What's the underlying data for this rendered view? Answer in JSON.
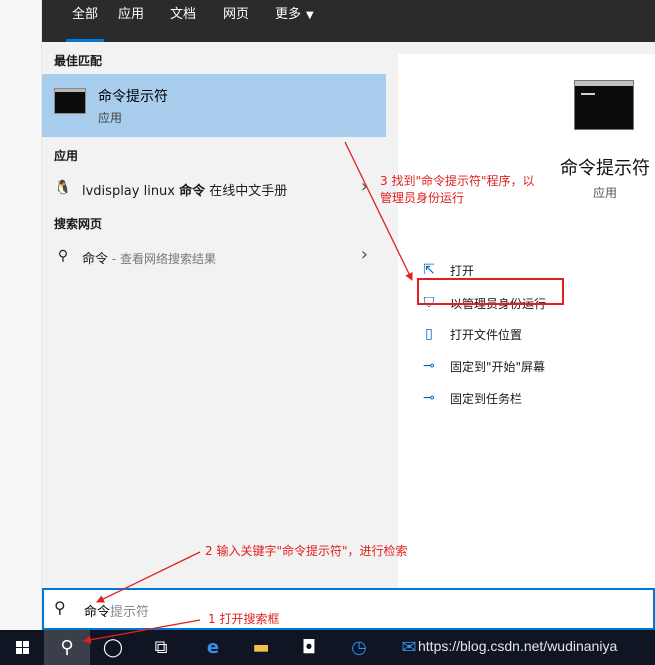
{
  "tabs": [
    {
      "label": "全部",
      "active": true
    },
    {
      "label": "应用"
    },
    {
      "label": "文档"
    },
    {
      "label": "网页"
    },
    {
      "label": "更多"
    }
  ],
  "results": {
    "best_match_header": "最佳匹配",
    "best_match": {
      "title": "命令提示符",
      "subtitle": "应用"
    },
    "apps_header": "应用",
    "app_item": {
      "prefix": "lvdisplay linux ",
      "bold": "命令",
      "suffix": " 在线中文手册"
    },
    "web_header": "搜索网页",
    "web_item": {
      "term": "命令",
      "suffix": " - 查看网络搜索结果"
    }
  },
  "detail": {
    "title": "命令提示符",
    "subtitle": "应用",
    "actions": [
      {
        "label": "打开",
        "icon": "open-icon"
      },
      {
        "label": "以管理员身份运行",
        "icon": "shield-icon"
      },
      {
        "label": "打开文件位置",
        "icon": "file-location-icon"
      },
      {
        "label": "固定到\"开始\"屏幕",
        "icon": "pin-icon"
      },
      {
        "label": "固定到任务栏",
        "icon": "pin-icon"
      }
    ]
  },
  "search": {
    "typed": "命令",
    "hint": "提示符"
  },
  "taskbar": {
    "watermark": "https://blog.csdn.net/wudinaniya"
  },
  "annotations": {
    "step1": "1 打开搜索框",
    "step2": "2 输入关键字\"命令提示符\"，进行检索",
    "step3_line1": "3 找到\"命令提示符\"程序，以",
    "step3_line2": "管理员身份运行"
  },
  "colors": {
    "accent": "#0078d7",
    "annotation": "#e02020",
    "selection": "#a9cdec"
  }
}
